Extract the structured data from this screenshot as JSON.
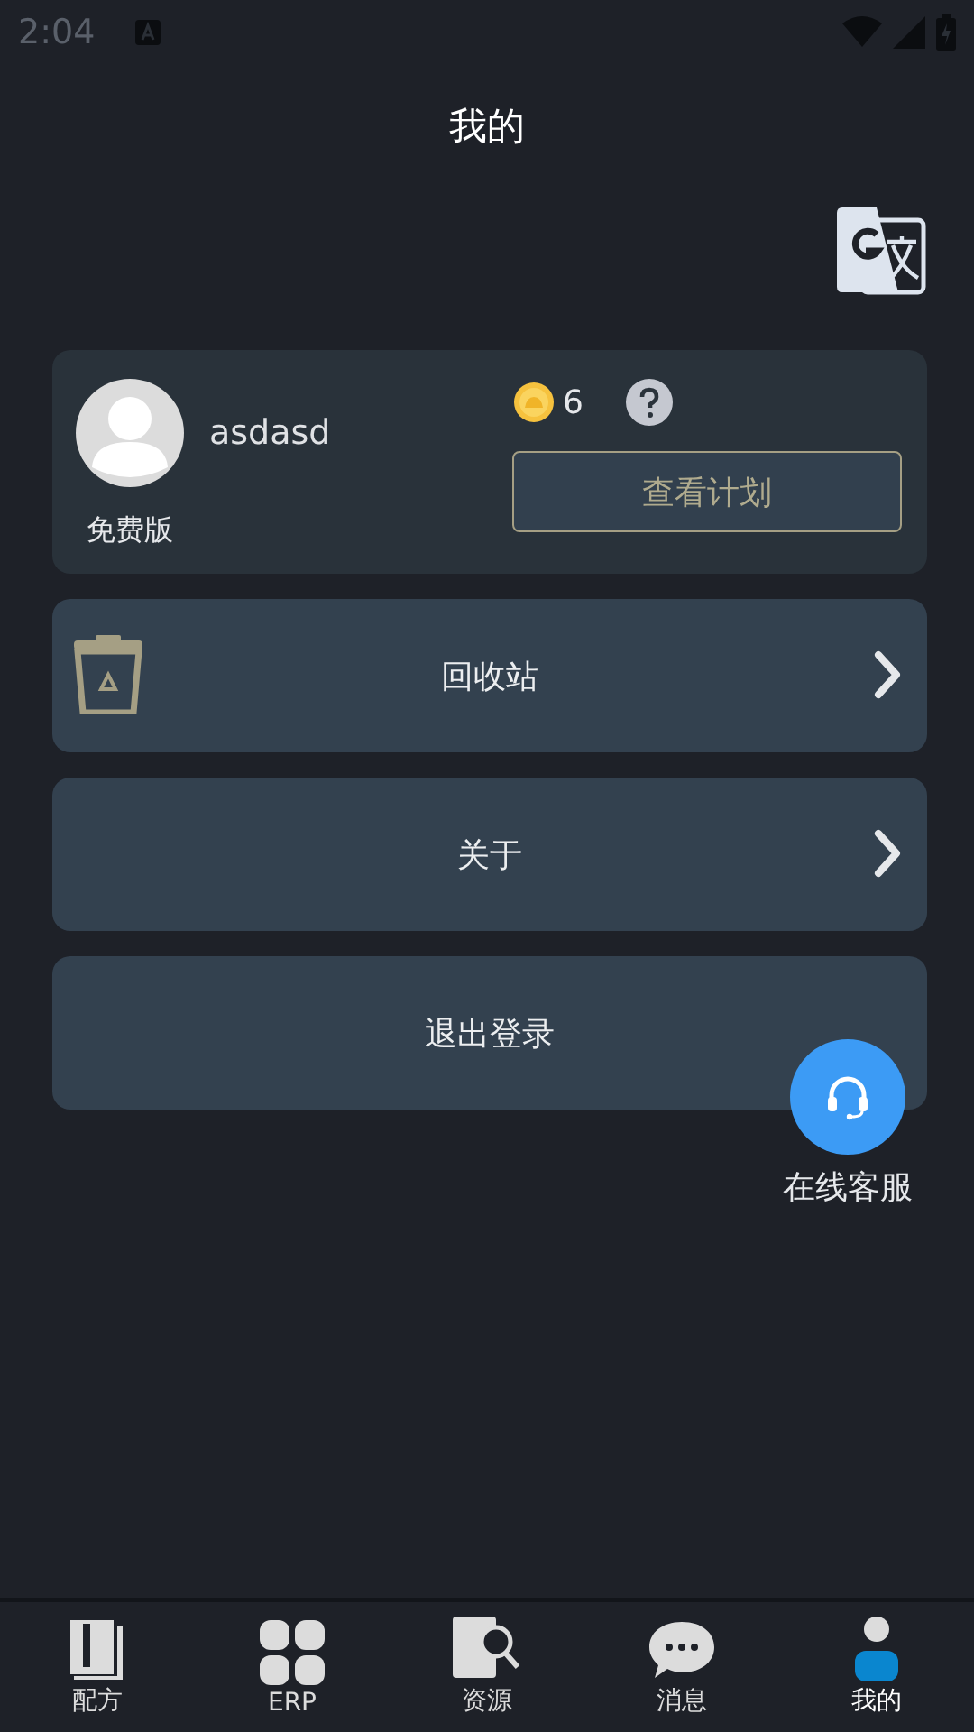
{
  "status_bar": {
    "time": "2:04"
  },
  "header": {
    "title": "我的"
  },
  "profile": {
    "username": "asdasd",
    "plan": "免费版",
    "coins": "6",
    "plan_button": "查看计划"
  },
  "menu": [
    {
      "label": "回收站",
      "kind": "recycle",
      "chevron": true
    },
    {
      "label": "关于",
      "kind": "plain",
      "chevron": true
    },
    {
      "label": "退出登录",
      "kind": "plain",
      "chevron": false
    }
  ],
  "support": {
    "label": "在线客服"
  },
  "tabs": [
    {
      "label": "配方",
      "kind": "book",
      "selected": false
    },
    {
      "label": "ERP",
      "kind": "grid",
      "selected": false
    },
    {
      "label": "资源",
      "kind": "search-book",
      "selected": false
    },
    {
      "label": "消息",
      "kind": "chat",
      "selected": false
    },
    {
      "label": "我的",
      "kind": "person",
      "selected": true
    }
  ]
}
